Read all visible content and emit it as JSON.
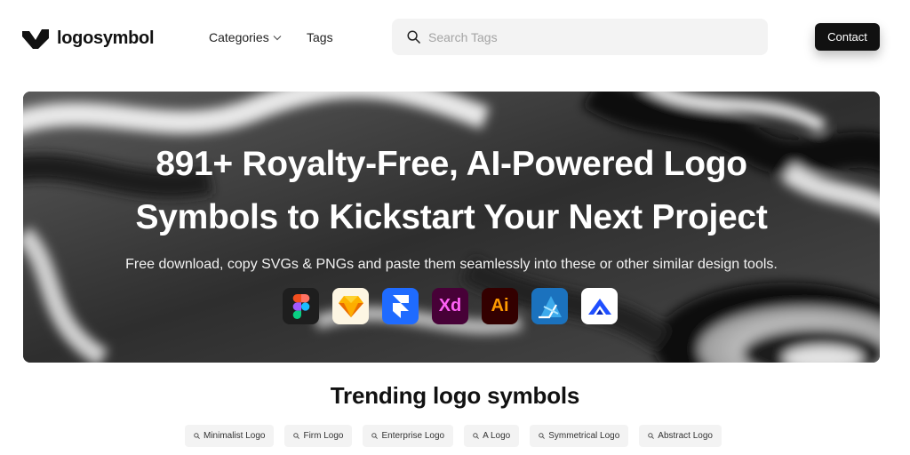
{
  "header": {
    "brand": "logosymbol",
    "nav": {
      "categories": "Categories",
      "tags": "Tags"
    },
    "search": {
      "placeholder": "Search Tags",
      "value": ""
    },
    "contact_label": "Contact"
  },
  "hero": {
    "title_line1": "891+ Royalty-Free, AI-Powered Logo",
    "title_line2": "Symbols to Kickstart Your Next Project",
    "subtitle": "Free download, copy SVGs & PNGs and paste them seamlessly into these or other similar design tools.",
    "tools": [
      {
        "name": "figma-icon",
        "label": "",
        "bg": "#1e1e1e"
      },
      {
        "name": "sketch-icon",
        "label": "",
        "bg": "#fdf6e3"
      },
      {
        "name": "framer-icon",
        "label": "",
        "bg": "#1f6bff"
      },
      {
        "name": "adobe-xd-icon",
        "label": "Xd",
        "bg": "#470137",
        "fg": "#ff61f6"
      },
      {
        "name": "adobe-illustrator-icon",
        "label": "Ai",
        "bg": "#330000",
        "fg": "#ff9a00"
      },
      {
        "name": "affinity-designer-icon",
        "label": "",
        "bg": "#1b72be"
      },
      {
        "name": "lunacy-icon",
        "label": "",
        "bg": "#ffffff"
      }
    ]
  },
  "trending": {
    "title": "Trending logo symbols",
    "tags": [
      "Minimalist Logo",
      "Firm Logo",
      "Enterprise Logo",
      "A Logo",
      "Symmetrical Logo",
      "Abstract Logo"
    ]
  }
}
